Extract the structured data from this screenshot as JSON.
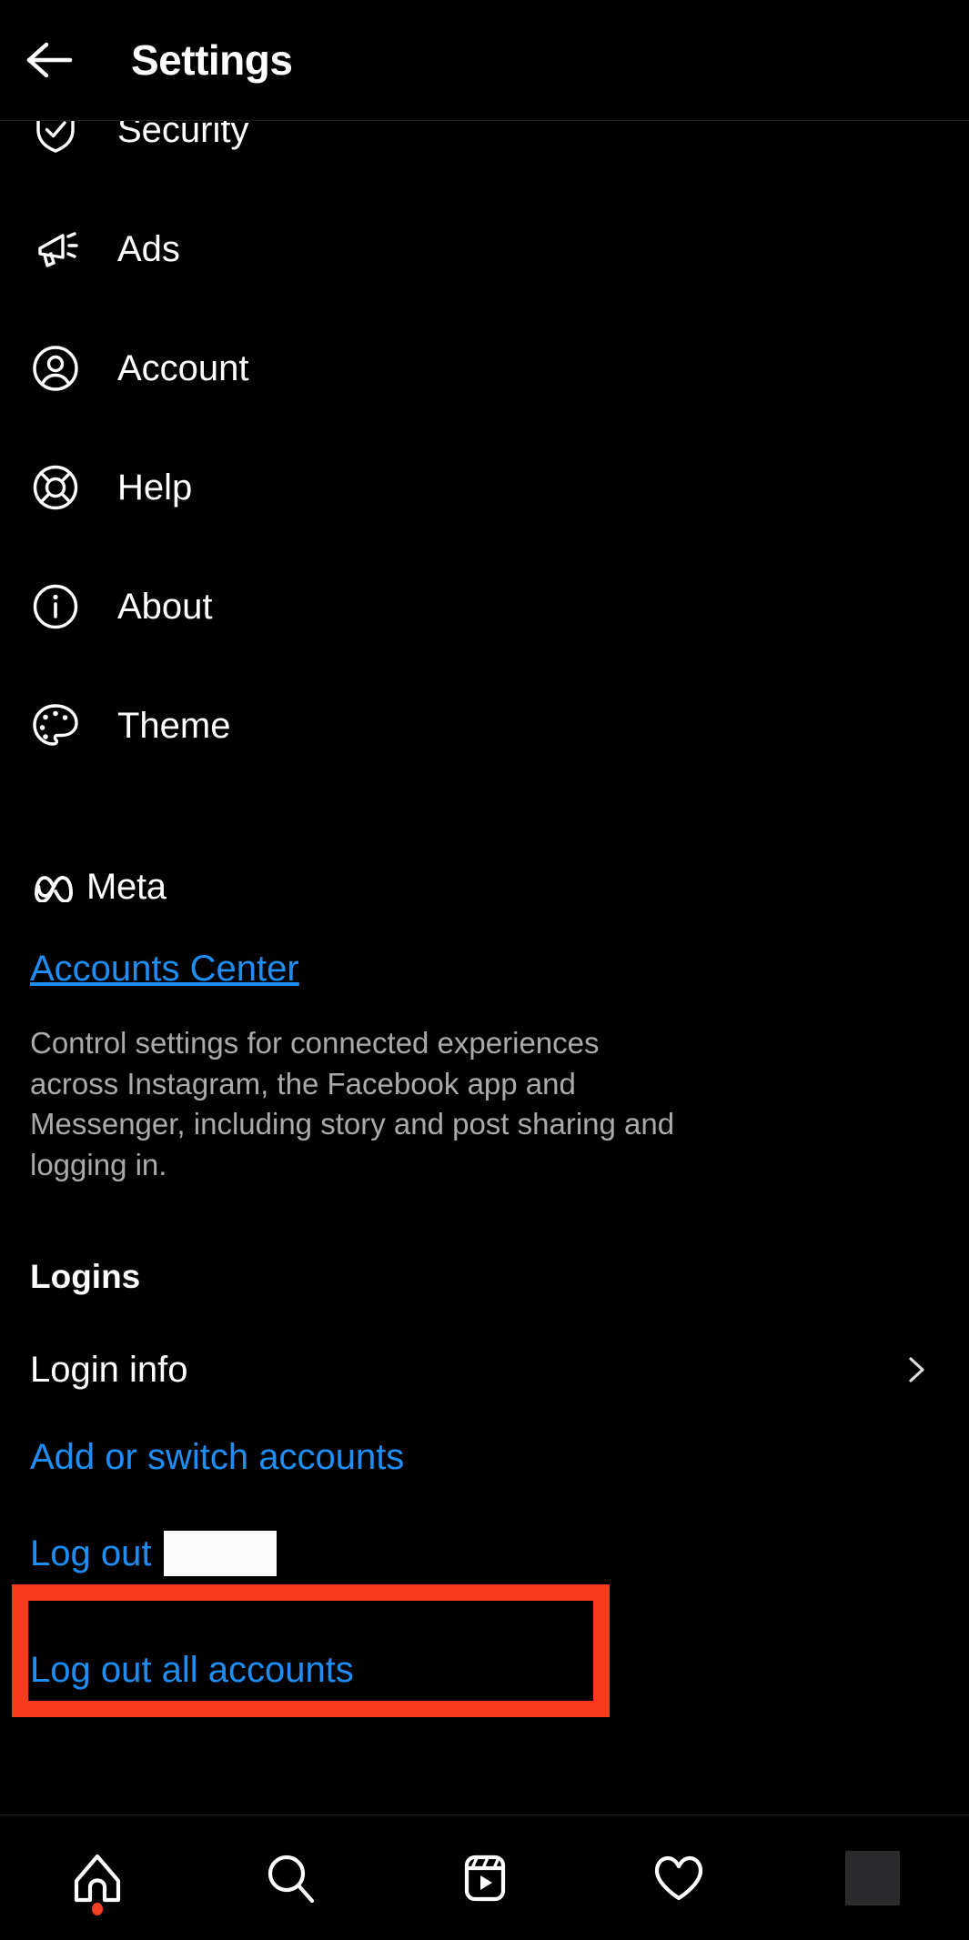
{
  "header": {
    "title": "Settings",
    "back_icon": "arrow-left-icon"
  },
  "settings_menu": [
    {
      "label": "Security",
      "icon": "shield-check-icon"
    },
    {
      "label": "Ads",
      "icon": "megaphone-icon"
    },
    {
      "label": "Account",
      "icon": "person-circle-icon"
    },
    {
      "label": "Help",
      "icon": "lifebuoy-icon"
    },
    {
      "label": "About",
      "icon": "info-circle-icon"
    },
    {
      "label": "Theme",
      "icon": "palette-icon"
    }
  ],
  "meta": {
    "logo_icon": "meta-infinity-icon",
    "wordmark": "Meta",
    "accounts_center_label": "Accounts Center",
    "description": "Control settings for connected experiences across Instagram, the Facebook app and Messenger, including story and post sharing and logging in."
  },
  "logins": {
    "heading": "Logins",
    "login_info_label": "Login info",
    "login_info_chevron": "chevron-right-icon",
    "add_or_switch_label": "Add or switch accounts",
    "log_out_label": "Log out",
    "log_out_username_redacted": "",
    "log_out_all_label": "Log out all accounts"
  },
  "annotation": {
    "color": "#F93A1C",
    "target": "log-out-row"
  },
  "bottom_nav": [
    {
      "name": "home",
      "icon": "home-icon",
      "has_badge": true
    },
    {
      "name": "search",
      "icon": "search-icon",
      "has_badge": false
    },
    {
      "name": "reels",
      "icon": "reels-icon",
      "has_badge": false
    },
    {
      "name": "activity",
      "icon": "heart-icon",
      "has_badge": false
    },
    {
      "name": "profile",
      "icon": "avatar-icon",
      "has_badge": false
    }
  ],
  "colors": {
    "background": "#000000",
    "text_primary": "#FFFFFF",
    "text_secondary": "#AAAAAA",
    "link_blue": "#1F8EF4",
    "annotation_red": "#F93A1C",
    "badge_red": "#F43F22"
  }
}
